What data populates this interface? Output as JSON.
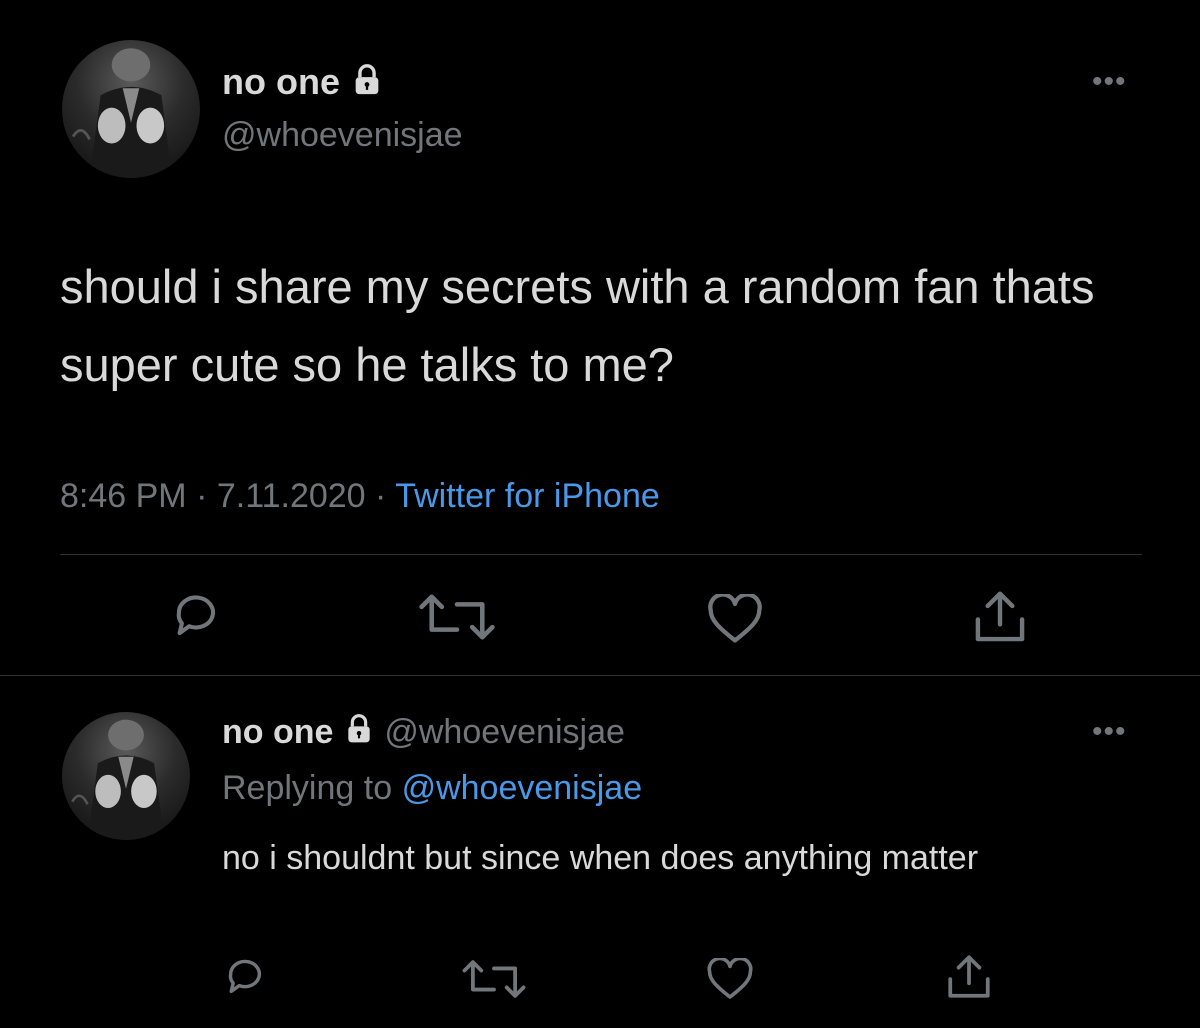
{
  "main_tweet": {
    "display_name": "no one",
    "handle": "@whoevenisjae",
    "text": "should i share my secrets with a random fan thats super cute so he talks to me?",
    "time": "8:46 PM",
    "date": "7.11.2020",
    "separator": "·",
    "source": "Twitter for iPhone",
    "more_label": "•••",
    "icons": {
      "avatar": "avatar-photo",
      "lock": "lock-icon",
      "reply": "reply-icon",
      "retweet": "retweet-icon",
      "like": "heart-icon",
      "share": "share-icon"
    }
  },
  "reply_tweet": {
    "display_name": "no one",
    "handle": "@whoevenisjae",
    "replying_prefix": "Replying to",
    "replying_to": "@whoevenisjae",
    "text": "no i shouldnt but since when does anything matter",
    "more_label": "•••"
  },
  "colors": {
    "background": "#000000",
    "primary_text": "#d9d9d9",
    "secondary_text": "#71767b",
    "link": "#4a99e9",
    "divider": "#2f3336"
  }
}
